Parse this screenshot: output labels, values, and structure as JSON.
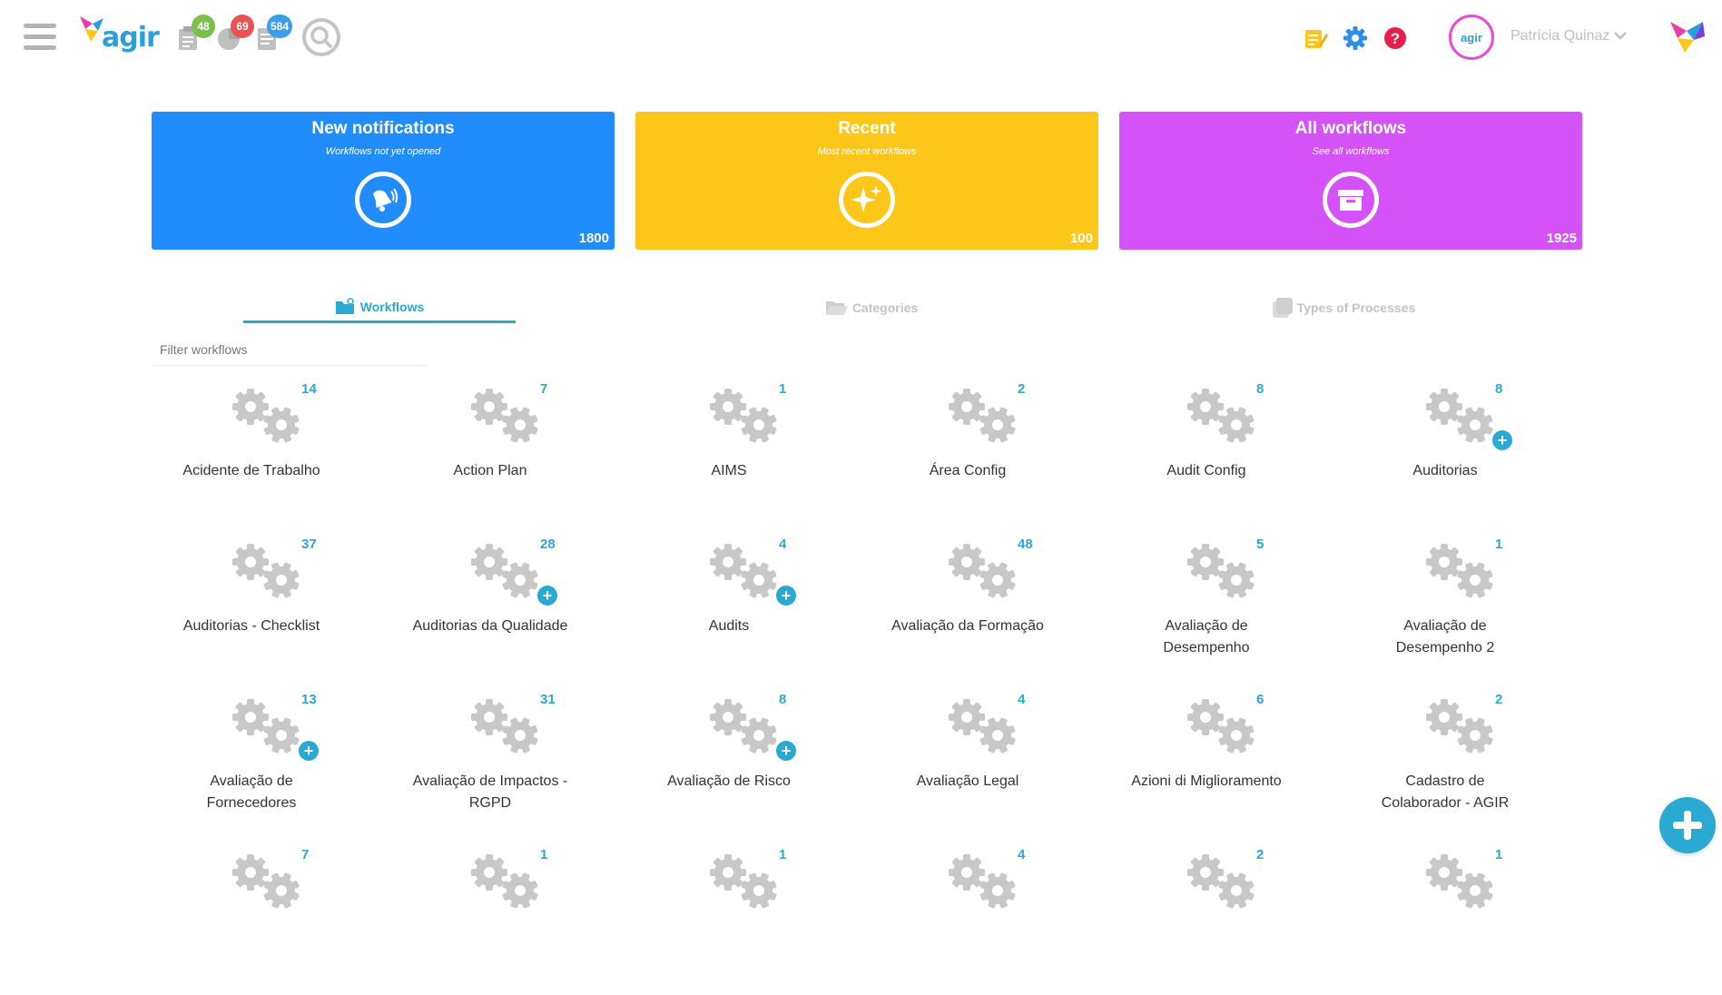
{
  "header": {
    "app_name": "agir",
    "badges": [
      {
        "icon": "clipboard-icon",
        "count": "48",
        "color": "#7cc14b"
      },
      {
        "icon": "pie-chart-icon",
        "count": "69",
        "color": "#e85353"
      },
      {
        "icon": "document-list-icon",
        "count": "584",
        "color": "#3a9ee8"
      }
    ],
    "user": {
      "initials": "agir",
      "name": "Patrícia Quinaz"
    }
  },
  "cards": [
    {
      "title": "New notifications",
      "subtitle": "Workflows not yet opened",
      "count": "1800",
      "color": "#218cfc",
      "icon": "bell-icon"
    },
    {
      "title": "Recent",
      "subtitle": "Most recent workflows",
      "count": "100",
      "color": "#fdc71a",
      "icon": "sparkle-icon"
    },
    {
      "title": "All workflows",
      "subtitle": "See all workflows",
      "count": "1925",
      "color": "#d551f8",
      "icon": "archive-box-icon"
    }
  ],
  "tabs": [
    {
      "label": "Workflows",
      "active": true
    },
    {
      "label": "Categories",
      "active": false
    },
    {
      "label": "Types of Processes",
      "active": false
    }
  ],
  "filter": {
    "placeholder": "Filter workflows"
  },
  "workflows": [
    {
      "label": "Acidente de Trabalho",
      "count": "14",
      "plus": false
    },
    {
      "label": "Action Plan",
      "count": "7",
      "plus": false
    },
    {
      "label": "AIMS",
      "count": "1",
      "plus": false
    },
    {
      "label": "Área Config",
      "count": "2",
      "plus": false
    },
    {
      "label": "Audit Config",
      "count": "8",
      "plus": false
    },
    {
      "label": "Auditorias",
      "count": "8",
      "plus": true
    },
    {
      "label": "Auditorias - Checklist",
      "count": "37",
      "plus": false
    },
    {
      "label": "Auditorias da Qualidade",
      "count": "28",
      "plus": true
    },
    {
      "label": "Audits",
      "count": "4",
      "plus": true
    },
    {
      "label": "Avaliação da Formação",
      "count": "48",
      "plus": false
    },
    {
      "label": "Avaliação de Desempenho",
      "count": "5",
      "plus": false
    },
    {
      "label": "Avaliação de Desempenho 2",
      "count": "1",
      "plus": false
    },
    {
      "label": "Avaliação de Fornecedores",
      "count": "13",
      "plus": true
    },
    {
      "label": "Avaliação de Impactos - RGPD",
      "count": "31",
      "plus": false
    },
    {
      "label": "Avaliação de Risco",
      "count": "8",
      "plus": true
    },
    {
      "label": "Avaliação Legal",
      "count": "4",
      "plus": false
    },
    {
      "label": "Azioni di Miglioramento",
      "count": "6",
      "plus": false
    },
    {
      "label": "Cadastro de Colaborador - AGIR",
      "count": "2",
      "plus": false
    },
    {
      "label": "",
      "count": "7",
      "plus": false
    },
    {
      "label": "",
      "count": "1",
      "plus": false
    },
    {
      "label": "",
      "count": "1",
      "plus": false
    },
    {
      "label": "",
      "count": "4",
      "plus": false
    },
    {
      "label": "",
      "count": "2",
      "plus": false
    },
    {
      "label": "",
      "count": "1",
      "plus": false
    }
  ]
}
